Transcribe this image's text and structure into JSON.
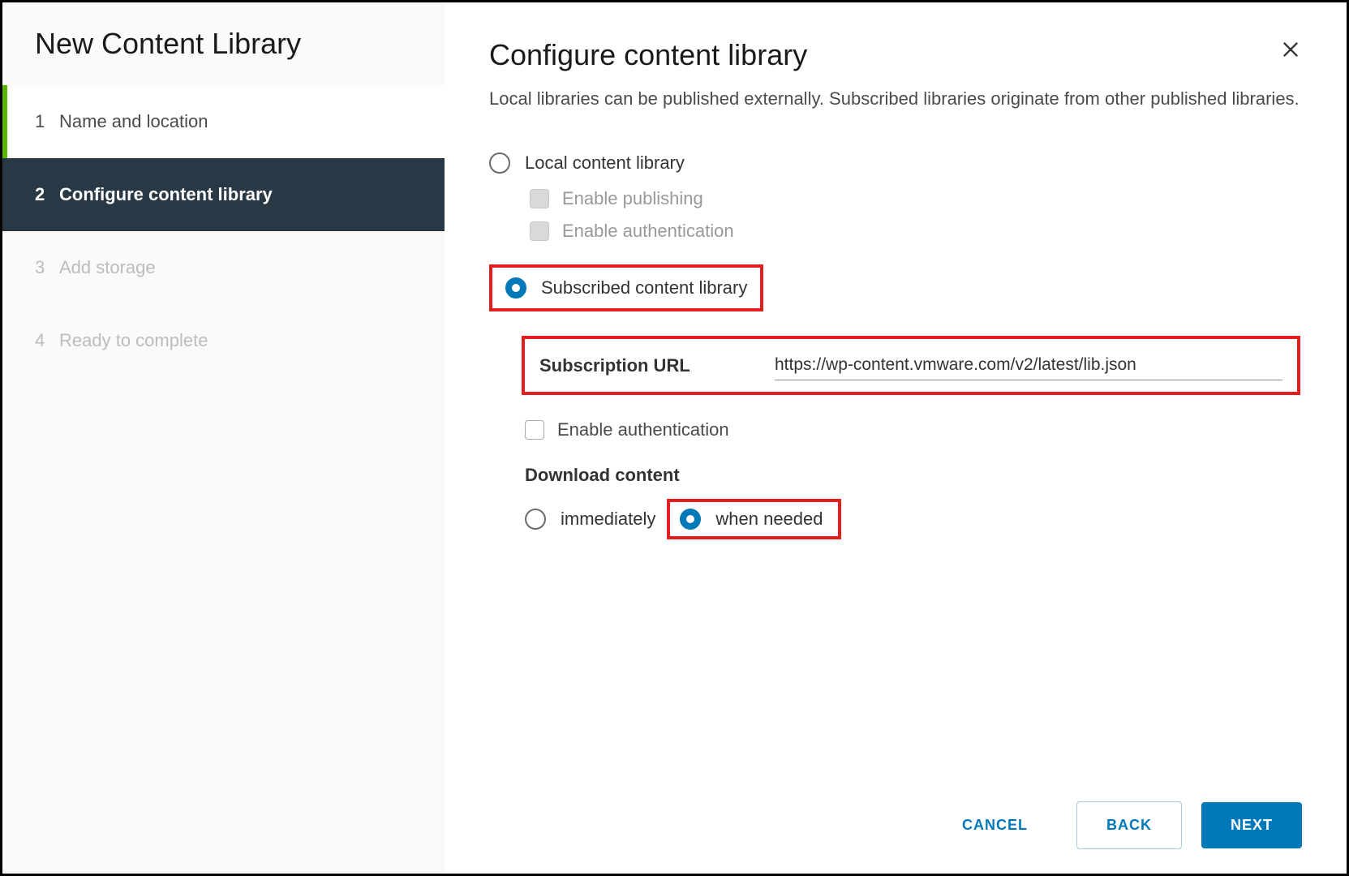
{
  "sidebar": {
    "title": "New Content Library",
    "steps": [
      {
        "num": "1",
        "label": "Name and location"
      },
      {
        "num": "2",
        "label": "Configure content library"
      },
      {
        "num": "3",
        "label": "Add storage"
      },
      {
        "num": "4",
        "label": "Ready to complete"
      }
    ]
  },
  "main": {
    "title": "Configure content library",
    "description": "Local libraries can be published externally. Subscribed libraries originate from other published libraries.",
    "options": {
      "local_label": "Local content library",
      "enable_publishing": "Enable publishing",
      "enable_authentication": "Enable authentication",
      "subscribed_label": "Subscribed content library",
      "subscription_url_label": "Subscription URL",
      "subscription_url_value": "https://wp-content.vmware.com/v2/latest/lib.json",
      "enable_auth_sub": "Enable authentication",
      "download_content_label": "Download content",
      "immediately_label": "immediately",
      "when_needed_label": "when needed"
    }
  },
  "footer": {
    "cancel": "CANCEL",
    "back": "BACK",
    "next": "NEXT"
  }
}
